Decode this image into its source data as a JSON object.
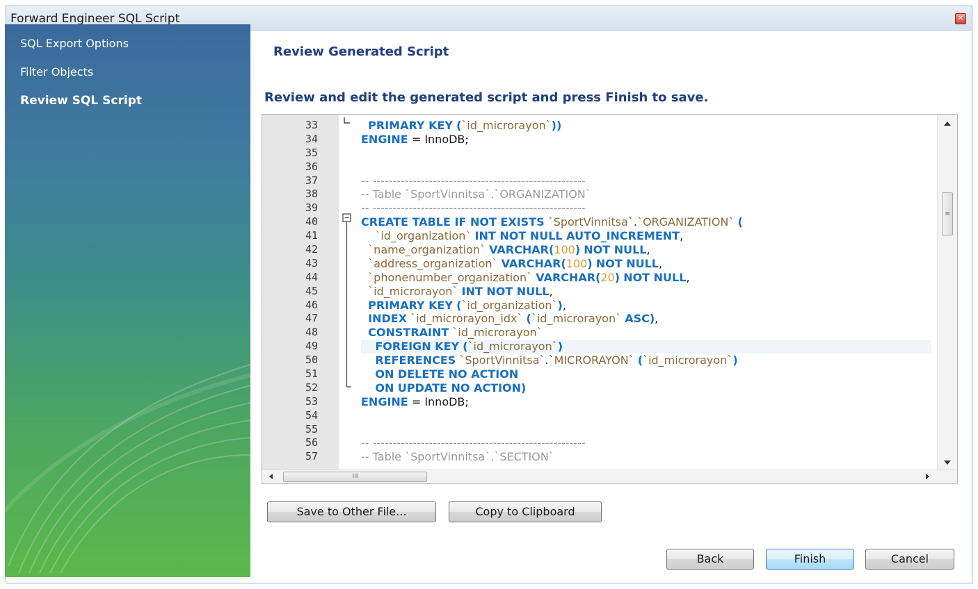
{
  "window": {
    "title": "Forward Engineer SQL Script",
    "close_glyph": "✕"
  },
  "sidebar": {
    "items": [
      {
        "label": "SQL Export Options",
        "active": false
      },
      {
        "label": "Filter Objects",
        "active": false
      },
      {
        "label": "Review SQL Script",
        "active": true
      }
    ]
  },
  "main": {
    "title": "Review Generated Script",
    "description": "Review and edit the generated script and press Finish to save."
  },
  "editor": {
    "line_numbers": [
      "33",
      "34",
      "35",
      "36",
      "37",
      "38",
      "39",
      "40",
      "41",
      "42",
      "43",
      "44",
      "45",
      "46",
      "47",
      "48",
      "49",
      "50",
      "51",
      "52",
      "53",
      "54",
      "55",
      "56",
      "57"
    ],
    "highlighted_line": "49",
    "code_lines": [
      "PRIMARY KEY (`id_microrayon`))",
      "ENGINE = InnoDB;",
      "",
      "",
      "-- -----------------------------------------------------",
      "-- Table `SportVinnitsa`.`ORGANIZATION`",
      "-- -----------------------------------------------------",
      "CREATE TABLE IF NOT EXISTS `SportVinnitsa`.`ORGANIZATION` (",
      "`id_organization` INT NOT NULL AUTO_INCREMENT,",
      "`name_organization` VARCHAR(100) NOT NULL,",
      "`address_organization` VARCHAR(100) NOT NULL,",
      "`phonenumber_organization` VARCHAR(20) NOT NULL,",
      "`id_microrayon` INT NOT NULL,",
      "PRIMARY KEY (`id_organization`),",
      "INDEX `id_microrayon_idx` (`id_microrayon` ASC),",
      "CONSTRAINT `id_microrayon`",
      "FOREIGN KEY (`id_microrayon`)",
      "REFERENCES `SportVinnitsa`.`MICRORAYON` (`id_microrayon`)",
      "ON DELETE NO ACTION",
      "ON UPDATE NO ACTION)",
      "ENGINE = InnoDB;",
      "",
      "",
      "-- -----------------------------------------------------",
      "-- Table `SportVinnitsa`.`SECTION`"
    ],
    "scroll_thumb_glyph": "≡",
    "hscroll_thumb_glyph": "III"
  },
  "buttons": {
    "save_other": "Save to Other File...",
    "copy_clipboard": "Copy to Clipboard",
    "back": "Back",
    "finish": "Finish",
    "cancel": "Cancel"
  },
  "colors": {
    "keyword": "#1a6fc0",
    "identifier": "#8a6a3a",
    "comment": "#9a9a9a",
    "number": "#e09a2a",
    "heading": "#1f3f80"
  }
}
